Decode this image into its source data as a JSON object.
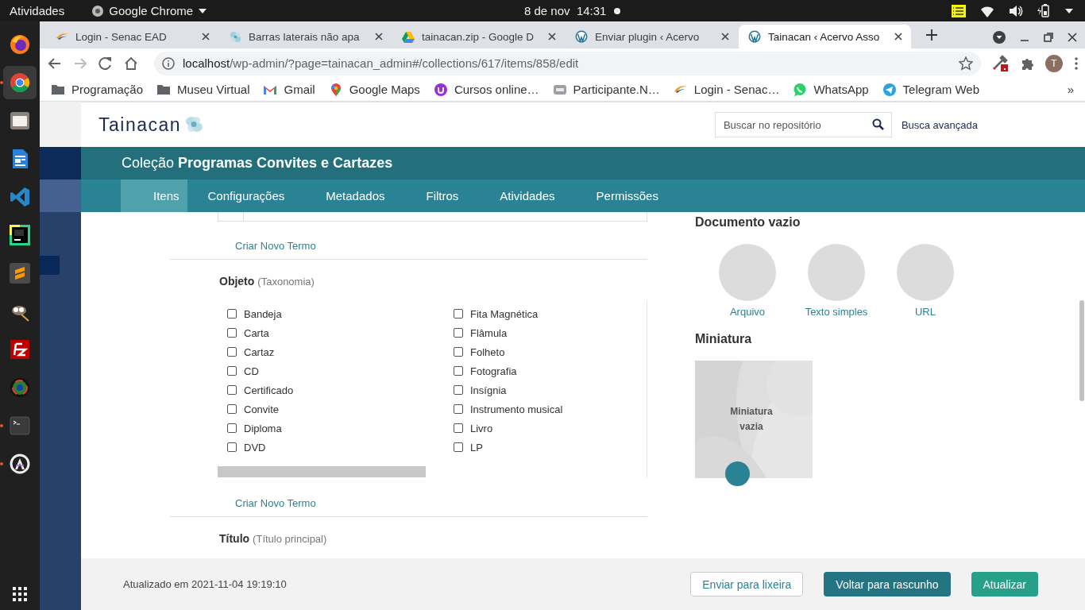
{
  "system_bar": {
    "activities": "Atividades",
    "app_name": "Google Chrome",
    "clock": "8 de nov  14:31"
  },
  "dock": [
    {
      "kind": "firefox",
      "selected": false,
      "running": false
    },
    {
      "kind": "chrome",
      "selected": true,
      "running": true
    },
    {
      "kind": "files",
      "selected": false,
      "running": false
    },
    {
      "kind": "writer",
      "selected": false,
      "running": false
    },
    {
      "kind": "vscode",
      "selected": false,
      "running": false
    },
    {
      "kind": "pycharm",
      "selected": false,
      "running": false
    },
    {
      "kind": "sublime",
      "selected": false,
      "running": false
    },
    {
      "kind": "gimp",
      "selected": false,
      "running": false
    },
    {
      "kind": "filezilla",
      "selected": false,
      "running": false
    },
    {
      "kind": "camera",
      "selected": false,
      "running": false
    },
    {
      "kind": "terminal",
      "selected": false,
      "running": true
    },
    {
      "kind": "software",
      "selected": false,
      "running": true
    }
  ],
  "browser": {
    "tabs": [
      {
        "kind": "senac",
        "title": "Login - Senac EAD",
        "selected": false
      },
      {
        "kind": "tainacan",
        "title": "Barras laterais não apa",
        "selected": false
      },
      {
        "kind": "drive",
        "title": "tainacan.zip - Google D",
        "selected": false
      },
      {
        "kind": "wordpress",
        "title": "Enviar plugin ‹ Acervo",
        "selected": false
      },
      {
        "kind": "wordpress",
        "title": "Tainacan ‹ Acervo Asso",
        "selected": true
      }
    ],
    "url_host": "localhost",
    "url_path": "/wp-admin/?page=tainacan_admin#/collections/617/items/858/edit",
    "profile_initial": "T",
    "bookmarks": [
      {
        "kind": "folder",
        "label": "Programação"
      },
      {
        "kind": "folder",
        "label": "Museu Virtual"
      },
      {
        "kind": "gmail",
        "label": "Gmail"
      },
      {
        "kind": "maps",
        "label": "Google Maps"
      },
      {
        "kind": "cursos",
        "label": "Cursos online…"
      },
      {
        "kind": "participante",
        "label": "Participante.N…"
      },
      {
        "kind": "senac",
        "label": "Login - Senac…"
      },
      {
        "kind": "whatsapp",
        "label": "WhatsApp"
      },
      {
        "kind": "telegram",
        "label": "Telegram Web"
      }
    ],
    "more": "»"
  },
  "site": {
    "logo": "Tainacan",
    "search": {
      "placeholder": "Buscar no repositório"
    },
    "advanced_search": "Busca avançada"
  },
  "collection_title": "Coleção **Programas Convites e Cartazes**",
  "nav_tabs": [
    {
      "label": "Itens",
      "selected": true
    },
    {
      "label": "Configurações",
      "selected": false
    },
    {
      "label": "Metadados",
      "selected": false
    },
    {
      "label": "Filtros",
      "selected": false
    },
    {
      "label": "Atividades",
      "selected": false
    },
    {
      "label": "Permissões",
      "selected": false
    }
  ],
  "form": {
    "first_section": {
      "create_link": "Criar Novo Termo"
    },
    "objeto": {
      "title": "Objeto",
      "subtitle": "(Taxonomia)",
      "create_link": "Criar Novo Termo",
      "options": [
        {
          "label": "Bandeja",
          "checked": false
        },
        {
          "label": "Carta",
          "checked": false
        },
        {
          "label": "Cartaz",
          "checked": false
        },
        {
          "label": "CD",
          "checked": false
        },
        {
          "label": "Certificado",
          "checked": false
        },
        {
          "label": "Convite",
          "checked": false
        },
        {
          "label": "Diploma",
          "checked": false
        },
        {
          "label": "DVD",
          "checked": false
        },
        {
          "label": "Fita Magnética",
          "checked": false
        },
        {
          "label": "Flâmula",
          "checked": false
        },
        {
          "label": "Folheto",
          "checked": false
        },
        {
          "label": "Fotografia",
          "checked": false
        },
        {
          "label": "Insígnia",
          "checked": false
        },
        {
          "label": "Instrumento musical",
          "checked": false
        },
        {
          "label": "Livro",
          "checked": false
        },
        {
          "label": "LP",
          "checked": false
        }
      ]
    },
    "next_field": {
      "title": "Título",
      "subtitle": "(Título principal)"
    }
  },
  "document": {
    "title": "Documento vazio",
    "options": [
      "Arquivo",
      "Texto simples",
      "URL"
    ]
  },
  "thumbnail": {
    "title": "Miniatura",
    "empty_text": "Miniatura vazia"
  },
  "footer": {
    "updated": "Atualizado em 2021-11-04 19:19:10",
    "buttons": [
      {
        "kind": "outline",
        "label": "Enviar para lixeira"
      },
      {
        "kind": "secondary",
        "label": "Voltar para rascunho"
      },
      {
        "kind": "primary",
        "label": "Atualizar"
      }
    ]
  }
}
